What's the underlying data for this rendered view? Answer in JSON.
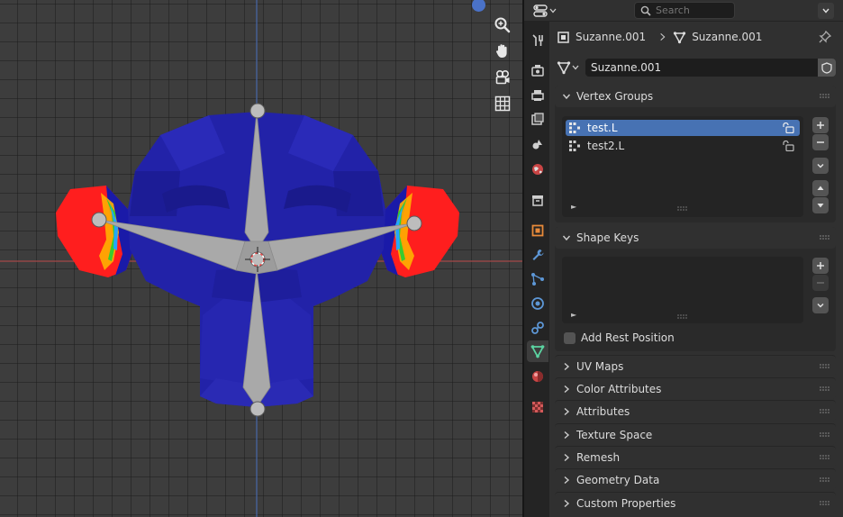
{
  "header": {
    "search_placeholder": "Search"
  },
  "breadcrumb": {
    "object_name": "Suzanne.001",
    "mesh_name": "Suzanne.001"
  },
  "mesh": {
    "name_field": "Suzanne.001"
  },
  "panels": {
    "vertex_groups": {
      "title": "Vertex Groups",
      "items": [
        {
          "label": "test.L",
          "selected": true
        },
        {
          "label": "test2.L",
          "selected": false
        }
      ]
    },
    "shape_keys": {
      "title": "Shape Keys",
      "add_rest_position_label": "Add Rest Position",
      "add_rest_position_checked": false
    },
    "collapsed": [
      {
        "title": "UV Maps"
      },
      {
        "title": "Color Attributes"
      },
      {
        "title": "Attributes"
      },
      {
        "title": "Texture Space"
      },
      {
        "title": "Remesh"
      },
      {
        "title": "Geometry Data"
      },
      {
        "title": "Custom Properties"
      }
    ]
  },
  "tabs": [
    {
      "icon": "tool-icon"
    },
    {
      "icon": "render-icon"
    },
    {
      "icon": "output-icon"
    },
    {
      "icon": "view-layer-icon"
    },
    {
      "icon": "scene-icon"
    },
    {
      "icon": "world-icon"
    },
    {
      "icon": "collection-icon"
    },
    {
      "icon": "object-icon"
    },
    {
      "icon": "modifier-icon"
    },
    {
      "icon": "particles-icon"
    },
    {
      "icon": "physics-icon"
    },
    {
      "icon": "constraints-icon"
    },
    {
      "icon": "mesh-data-icon",
      "active": true
    },
    {
      "icon": "material-icon"
    },
    {
      "icon": "texture-icon"
    }
  ],
  "colors": {
    "selection": "#4772b3",
    "mesh_data_tab": "#5bd3a1",
    "mesh_blue": "#2222a8",
    "weight_red": "#ff1e1e",
    "bone_gray": "#a8a8a8",
    "x_axis": "#b54a4a",
    "y_axis": "#4a6fb5"
  }
}
